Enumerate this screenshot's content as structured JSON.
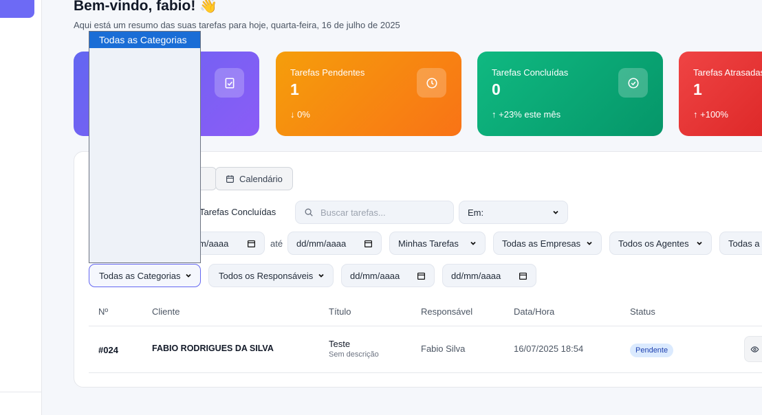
{
  "header": {
    "greeting": "Bem-vindo, fabio! 👋",
    "subtitle": "Aqui está um resumo das suas tarefas para hoje, quarta-feira, 16 de julho de 2025"
  },
  "stats": {
    "pending": {
      "label": "Tarefas Pendentes",
      "value": "1",
      "trend": "0%",
      "icon": "clock-icon",
      "color": "#f97316"
    },
    "completed": {
      "label": "Tarefas Concluídas",
      "value": "0",
      "trend": "+23% este mês",
      "icon": "check-circle-icon",
      "color": "#10b981"
    },
    "overdue": {
      "label": "Tarefas Atrasadas",
      "value": "1",
      "trend": "+100%",
      "icon": "alert-icon",
      "color": "#ef4444"
    },
    "total": {
      "icon": "clipboard-check-icon",
      "color": "#6366f1"
    }
  },
  "view_toggle": {
    "calendar_label": "Calendário"
  },
  "filters": {
    "show_completed_label": "Tarefas Concluídas",
    "search_placeholder": "Buscar tarefas...",
    "in_select": "Em:",
    "date_from_partial": "m/aaaa",
    "until_label": "até",
    "date_to": "dd/mm/aaaa",
    "my_tasks": "Minhas Tarefas",
    "companies": "Todas as Empresas",
    "agents": "Todos os Agentes",
    "more": "Todas a",
    "categories": "Todas as Categorias",
    "responsibles": "Todos os Responsáveis",
    "date_start": "dd/mm/aaaa",
    "date_end": "dd/mm/aaaa"
  },
  "category_dropdown": {
    "selected_option": "Todas as Categorias"
  },
  "table": {
    "columns": [
      "Nº",
      "Cliente",
      "Título",
      "Responsável",
      "Data/Hora",
      "Status"
    ],
    "rows": [
      {
        "number": "#024",
        "client": "FABIO RODRIGUES DA SILVA",
        "title": "Teste",
        "description": "Sem descrição",
        "responsible": "Fabio Silva",
        "datetime": "16/07/2025 18:54",
        "status": "Pendente"
      }
    ]
  }
}
